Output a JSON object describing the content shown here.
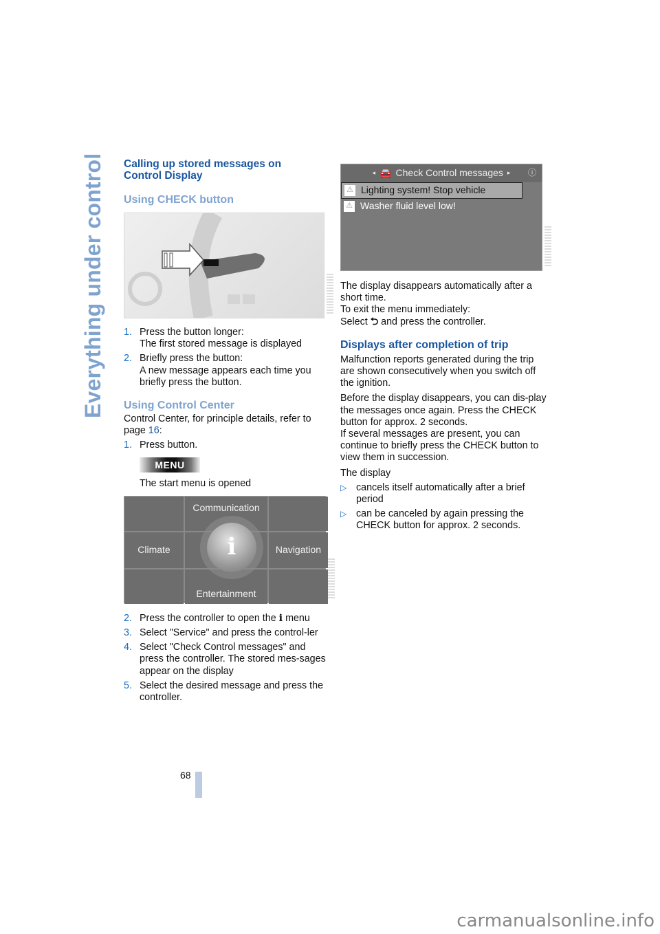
{
  "side_title": "Everything under control",
  "left": {
    "section_title": "Calling up stored messages on Control Display",
    "check_heading": "Using CHECK button",
    "check_steps": [
      {
        "num": "1.",
        "text": "Press the button longer:",
        "detail": "The first stored message is displayed"
      },
      {
        "num": "2.",
        "text": "Briefly press the button:",
        "detail": "A new message appears each time you briefly press the button."
      }
    ],
    "cc_heading": "Using Control Center",
    "cc_intro_pre": "Control Center, for principle details, refer to page ",
    "cc_intro_link": "16",
    "cc_intro_post": ":",
    "cc_step1": {
      "num": "1.",
      "text": "Press button."
    },
    "menu_button": "MENU",
    "start_menu_text": "The start menu is opened",
    "start_menu": {
      "top": "Communication",
      "left": "Climate",
      "right": "Navigation",
      "bottom": "Entertainment",
      "center": "i"
    },
    "steps_after": [
      {
        "num": "2.",
        "text_pre": "Press the controller to open the ",
        "icon": "i",
        "text_post": " menu"
      },
      {
        "num": "3.",
        "text": "Select \"Service\" and press the control-ler"
      },
      {
        "num": "4.",
        "text": "Select \"Check Control messages\" and press the controller. The stored mes-sages appear on the display"
      },
      {
        "num": "5.",
        "text": "Select the desired message and press the controller."
      }
    ]
  },
  "right": {
    "screen": {
      "title": "Check Control messages",
      "messages": [
        "Lighting system! Stop vehicle",
        "Washer fluid level low!"
      ]
    },
    "display_text_1": "The display disappears automatically after a short time.",
    "display_text_2": "To exit the menu immediately:",
    "display_text_3_pre": "Select ",
    "display_text_3_post": " and press the controller.",
    "trip_heading": "Displays after completion of trip",
    "trip_p1": "Malfunction reports generated during the trip are shown consecutively when you switch off the ignition.",
    "trip_p2": "Before the display disappears, you can dis-play the messages once again. Press the CHECK button for approx. 2 seconds.",
    "trip_p3": "If several messages are present, you can continue to briefly press the CHECK button to view them in succession.",
    "display_label": "The display",
    "bullets": [
      "cancels itself automatically after a brief period",
      "can be canceled by again pressing the CHECK button for approx. 2 seconds."
    ]
  },
  "page_number": "68",
  "watermark": "carmanualsonline.info"
}
